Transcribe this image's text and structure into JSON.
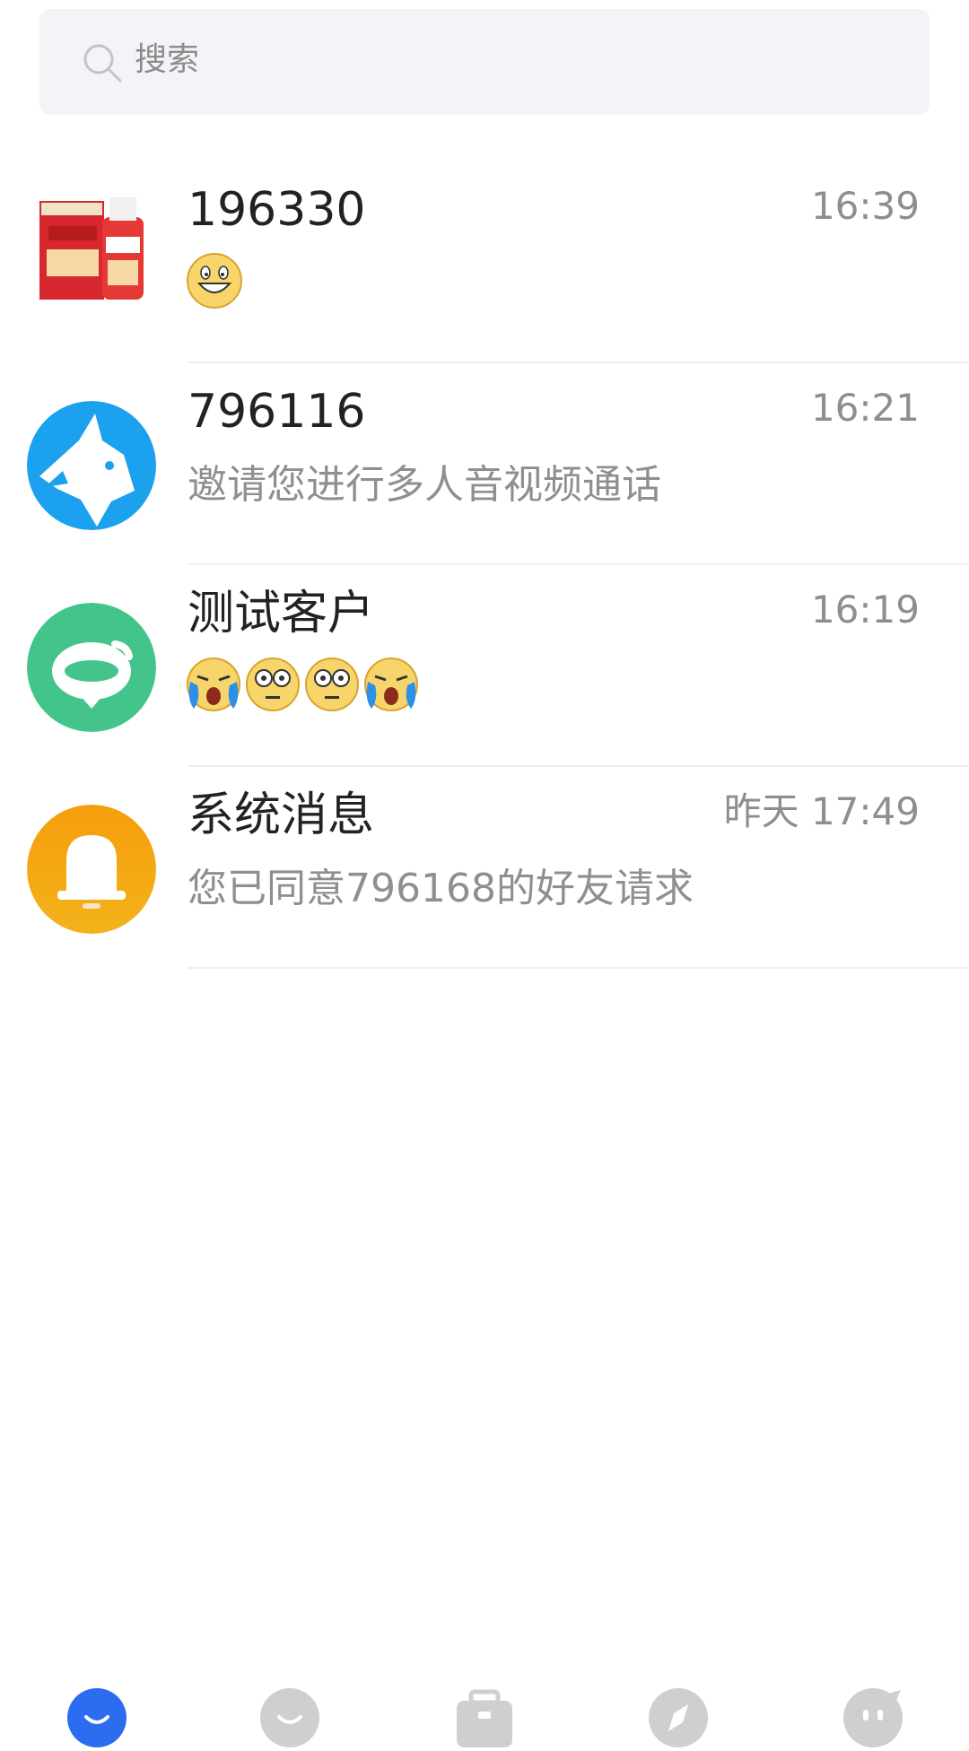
{
  "search": {
    "placeholder": "搜索"
  },
  "conversations": [
    {
      "name": "196330",
      "time": "16:39",
      "preview_type": "emoji",
      "emojis": [
        "grin-emoji"
      ]
    },
    {
      "name": "796116",
      "time": "16:21",
      "preview": "邀请您进行多人音视频通话"
    },
    {
      "name": "测试客户",
      "time": "16:19",
      "preview_type": "emoji",
      "emojis": [
        "crying-emoji",
        "stunned-emoji",
        "stunned-emoji",
        "crying-emoji"
      ]
    },
    {
      "name": "系统消息",
      "time": "昨天 17:49",
      "preview": "您已同意796168的好友请求"
    }
  ],
  "tabbar": {
    "active_color": "#2b6cf0",
    "inactive_color": "#cfcfcf",
    "tabs": [
      "chat-icon",
      "contacts-icon",
      "workbench-icon",
      "discover-icon",
      "me-icon"
    ]
  }
}
